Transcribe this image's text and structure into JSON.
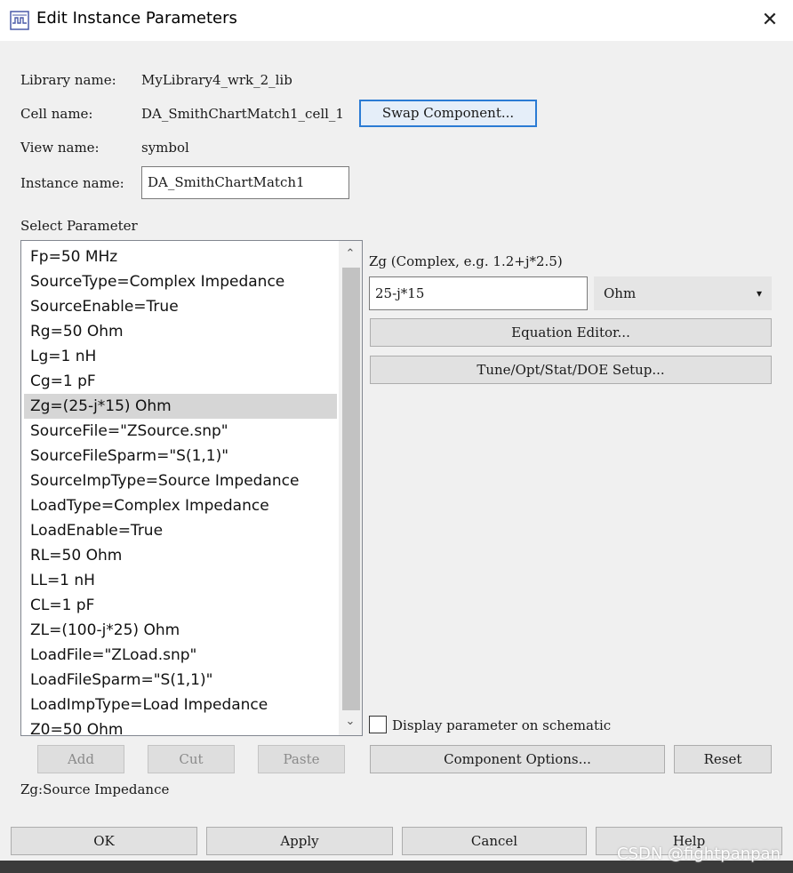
{
  "window": {
    "title": "Edit Instance Parameters",
    "close_glyph": "✕"
  },
  "info": {
    "library_label": "Library name:",
    "library_value": "MyLibrary4_wrk_2_lib",
    "cell_label": "Cell name:",
    "cell_value": "DA_SmithChartMatch1_cell_1",
    "swap_button": "Swap Component...",
    "view_label": "View name:",
    "view_value": "symbol",
    "instance_label": "Instance name:",
    "instance_value": "DA_SmithChartMatch1"
  },
  "select_parameter_label": "Select Parameter",
  "parameters": [
    "Fp=50 MHz",
    "SourceType=Complex Impedance",
    "SourceEnable=True",
    "Rg=50 Ohm",
    "Lg=1 nH",
    "Cg=1 pF",
    "Zg=(25-j*15) Ohm",
    "SourceFile=\"ZSource.snp\"",
    "SourceFileSparm=\"S(1,1)\"",
    "SourceImpType=Source Impedance",
    "LoadType=Complex Impedance",
    "LoadEnable=True",
    "RL=50 Ohm",
    "LL=1 nH",
    "CL=1 pF",
    "ZL=(100-j*25) Ohm",
    "LoadFile=\"ZLoad.snp\"",
    "LoadFileSparm=\"S(1,1)\"",
    "LoadImpType=Load Impedance",
    "Z0=50 Ohm"
  ],
  "selected_index": 6,
  "scroll": {
    "up_glyph": "⌃",
    "down_glyph": "⌄"
  },
  "editor": {
    "param_label": "Zg (Complex, e.g. 1.2+j*2.5)",
    "value": "25-j*15",
    "unit": "Ohm",
    "unit_arrow": "▾",
    "equation_button": "Equation Editor...",
    "tune_button": "Tune/Opt/Stat/DOE Setup...",
    "display_checkbox_label": "Display parameter on schematic",
    "display_checked": false
  },
  "list_actions": {
    "add": "Add",
    "cut": "Cut",
    "paste": "Paste"
  },
  "component_options_button": "Component Options...",
  "reset_button": "Reset",
  "status_text": "Zg:Source Impedance",
  "footer": {
    "ok": "OK",
    "apply": "Apply",
    "cancel": "Cancel",
    "help": "Help"
  },
  "watermark": "CSDN @fightpanpan",
  "colors": {
    "focus_border": "#2b7bd4",
    "selection": "#d6d6d6",
    "title_bg": "#ffffff",
    "dialog_bg": "#f0f0f0"
  }
}
